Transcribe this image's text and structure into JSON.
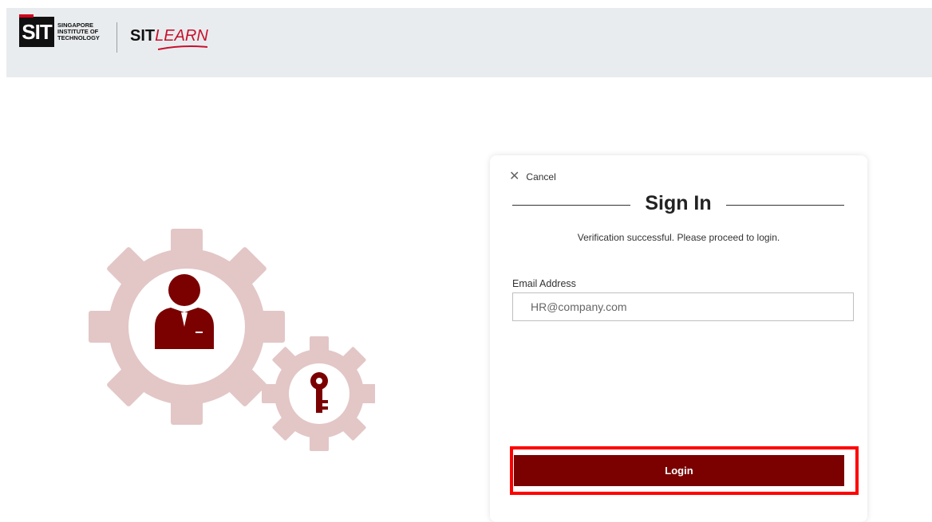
{
  "header": {
    "sit_logo_text": "SIT",
    "sit_logo_line1": "SINGAPORE",
    "sit_logo_line2": "INSTITUTE OF",
    "sit_logo_line3": "TECHNOLOGY",
    "sitlearn_prefix": "SIT",
    "sitlearn_suffix": "LEARN",
    "accent_color": "#c8102e"
  },
  "card": {
    "cancel_label": "Cancel",
    "title": "Sign In",
    "message": "Verification successful. Please proceed to login.",
    "email_label": "Email Address",
    "email_placeholder": "HR@company.com",
    "login_label": "Login",
    "button_color": "#7b0000"
  },
  "illustration": {
    "gear_color": "#e3c6c6",
    "icon_color": "#7b0000",
    "icons": [
      "user-icon",
      "key-icon"
    ]
  }
}
